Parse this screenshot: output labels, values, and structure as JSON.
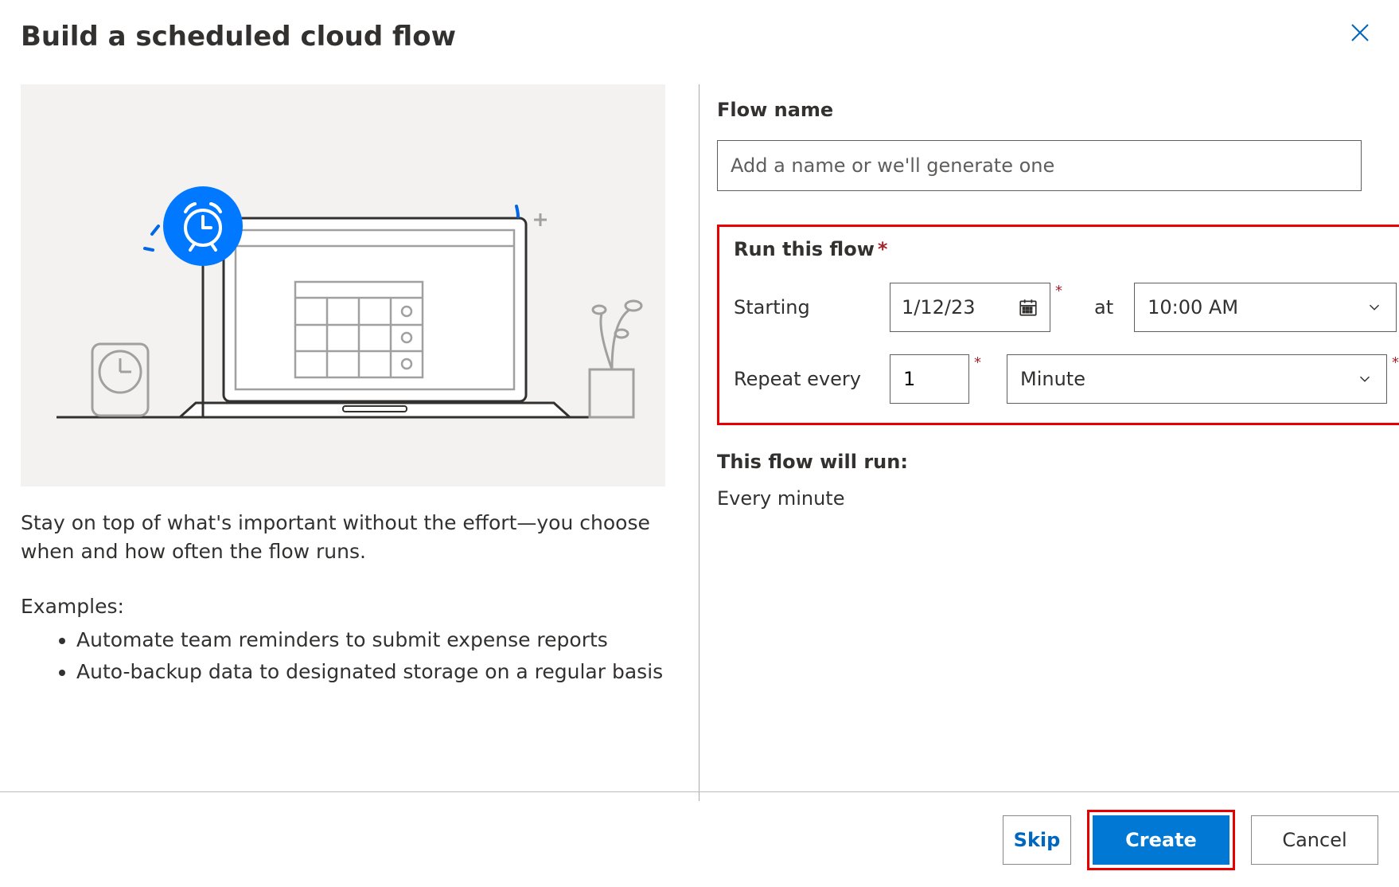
{
  "header": {
    "title": "Build a scheduled cloud flow"
  },
  "left": {
    "description": "Stay on top of what's important without the effort—you choose when and how often the flow runs.",
    "examples_label": "Examples:",
    "examples": [
      "Automate team reminders to submit expense reports",
      "Auto-backup data to designated storage on a regular basis"
    ]
  },
  "form": {
    "flow_name_label": "Flow name",
    "flow_name_placeholder": "Add a name or we'll generate one",
    "flow_name_value": "",
    "run_section_label": "Run this flow",
    "starting_label": "Starting",
    "starting_date": "1/12/23",
    "at_label": "at",
    "starting_time": "10:00 AM",
    "repeat_label": "Repeat every",
    "repeat_count": "1",
    "repeat_unit": "Minute",
    "summary_label": "This flow will run:",
    "summary_text": "Every minute"
  },
  "footer": {
    "skip": "Skip",
    "create": "Create",
    "cancel": "Cancel"
  }
}
